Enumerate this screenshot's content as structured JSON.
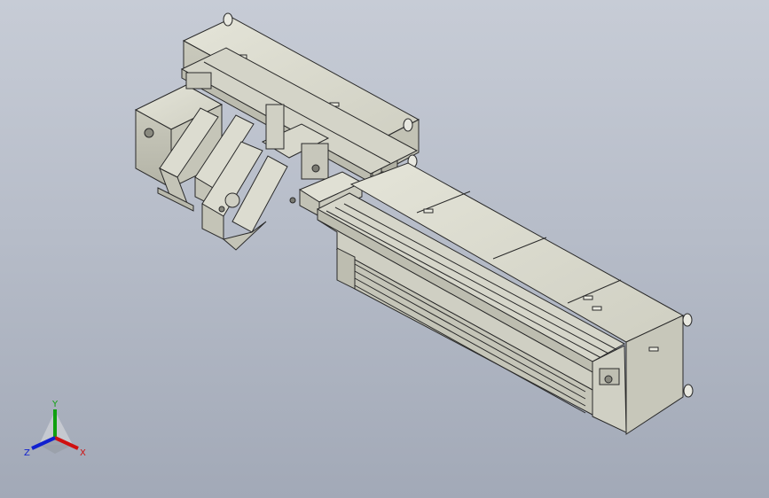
{
  "viewport": {
    "background_top": "#c7ccd6",
    "background_bottom": "#a2a9b7"
  },
  "model": {
    "body_color": "#d8d8cc",
    "body_shadow_color": "#b9b9ad",
    "line_color": "#2a2a2a"
  },
  "triad": {
    "x_label": "X",
    "y_label": "Y",
    "z_label": "Z",
    "x_color": "#d01010",
    "y_color": "#10a010",
    "z_color": "#1020d0"
  }
}
